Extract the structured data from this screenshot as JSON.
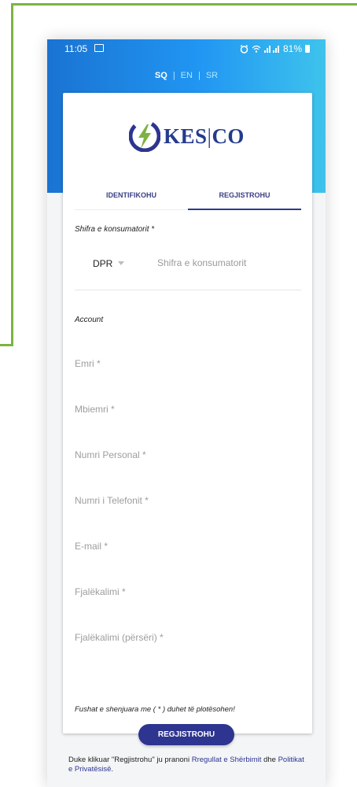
{
  "status_bar": {
    "time": "11:05",
    "battery": "81%"
  },
  "languages": [
    {
      "code": "SQ",
      "active": true
    },
    {
      "code": "EN",
      "active": false
    },
    {
      "code": "SR",
      "active": false
    }
  ],
  "brand": {
    "name_left": "KES",
    "name_right": "CO",
    "primary_color": "#2d3590",
    "accent_color": "#7cb342"
  },
  "tabs": [
    {
      "label": "IDENTIFIKOHU",
      "active": false
    },
    {
      "label": "REGJISTROHU",
      "active": true
    }
  ],
  "consumer": {
    "label": "Shifra e konsumatorit *",
    "prefix": "DPR",
    "placeholder": "Shifra e konsumatorit"
  },
  "account": {
    "label": "Account",
    "fields": [
      {
        "placeholder": "Emri *"
      },
      {
        "placeholder": "Mbiemri *"
      },
      {
        "placeholder": "Numri Personal *"
      },
      {
        "placeholder": "Numri i Telefonit *"
      },
      {
        "placeholder": "E-mail *"
      },
      {
        "placeholder": "Fjalëkalimi *"
      },
      {
        "placeholder": "Fjalëkalimi (përsëri) *"
      }
    ]
  },
  "required_note": "Fushat e shenjuara me ( * ) duhet të plotësohen!",
  "submit_label": "REGJISTROHU",
  "terms": {
    "prefix": "Duke klikuar \"Regjistrohu\" ju pranoni ",
    "link1": "Rregullat e Shërbimit",
    "middle": " dhe ",
    "link2": "Politikat e Privatësisë",
    "suffix": "."
  }
}
